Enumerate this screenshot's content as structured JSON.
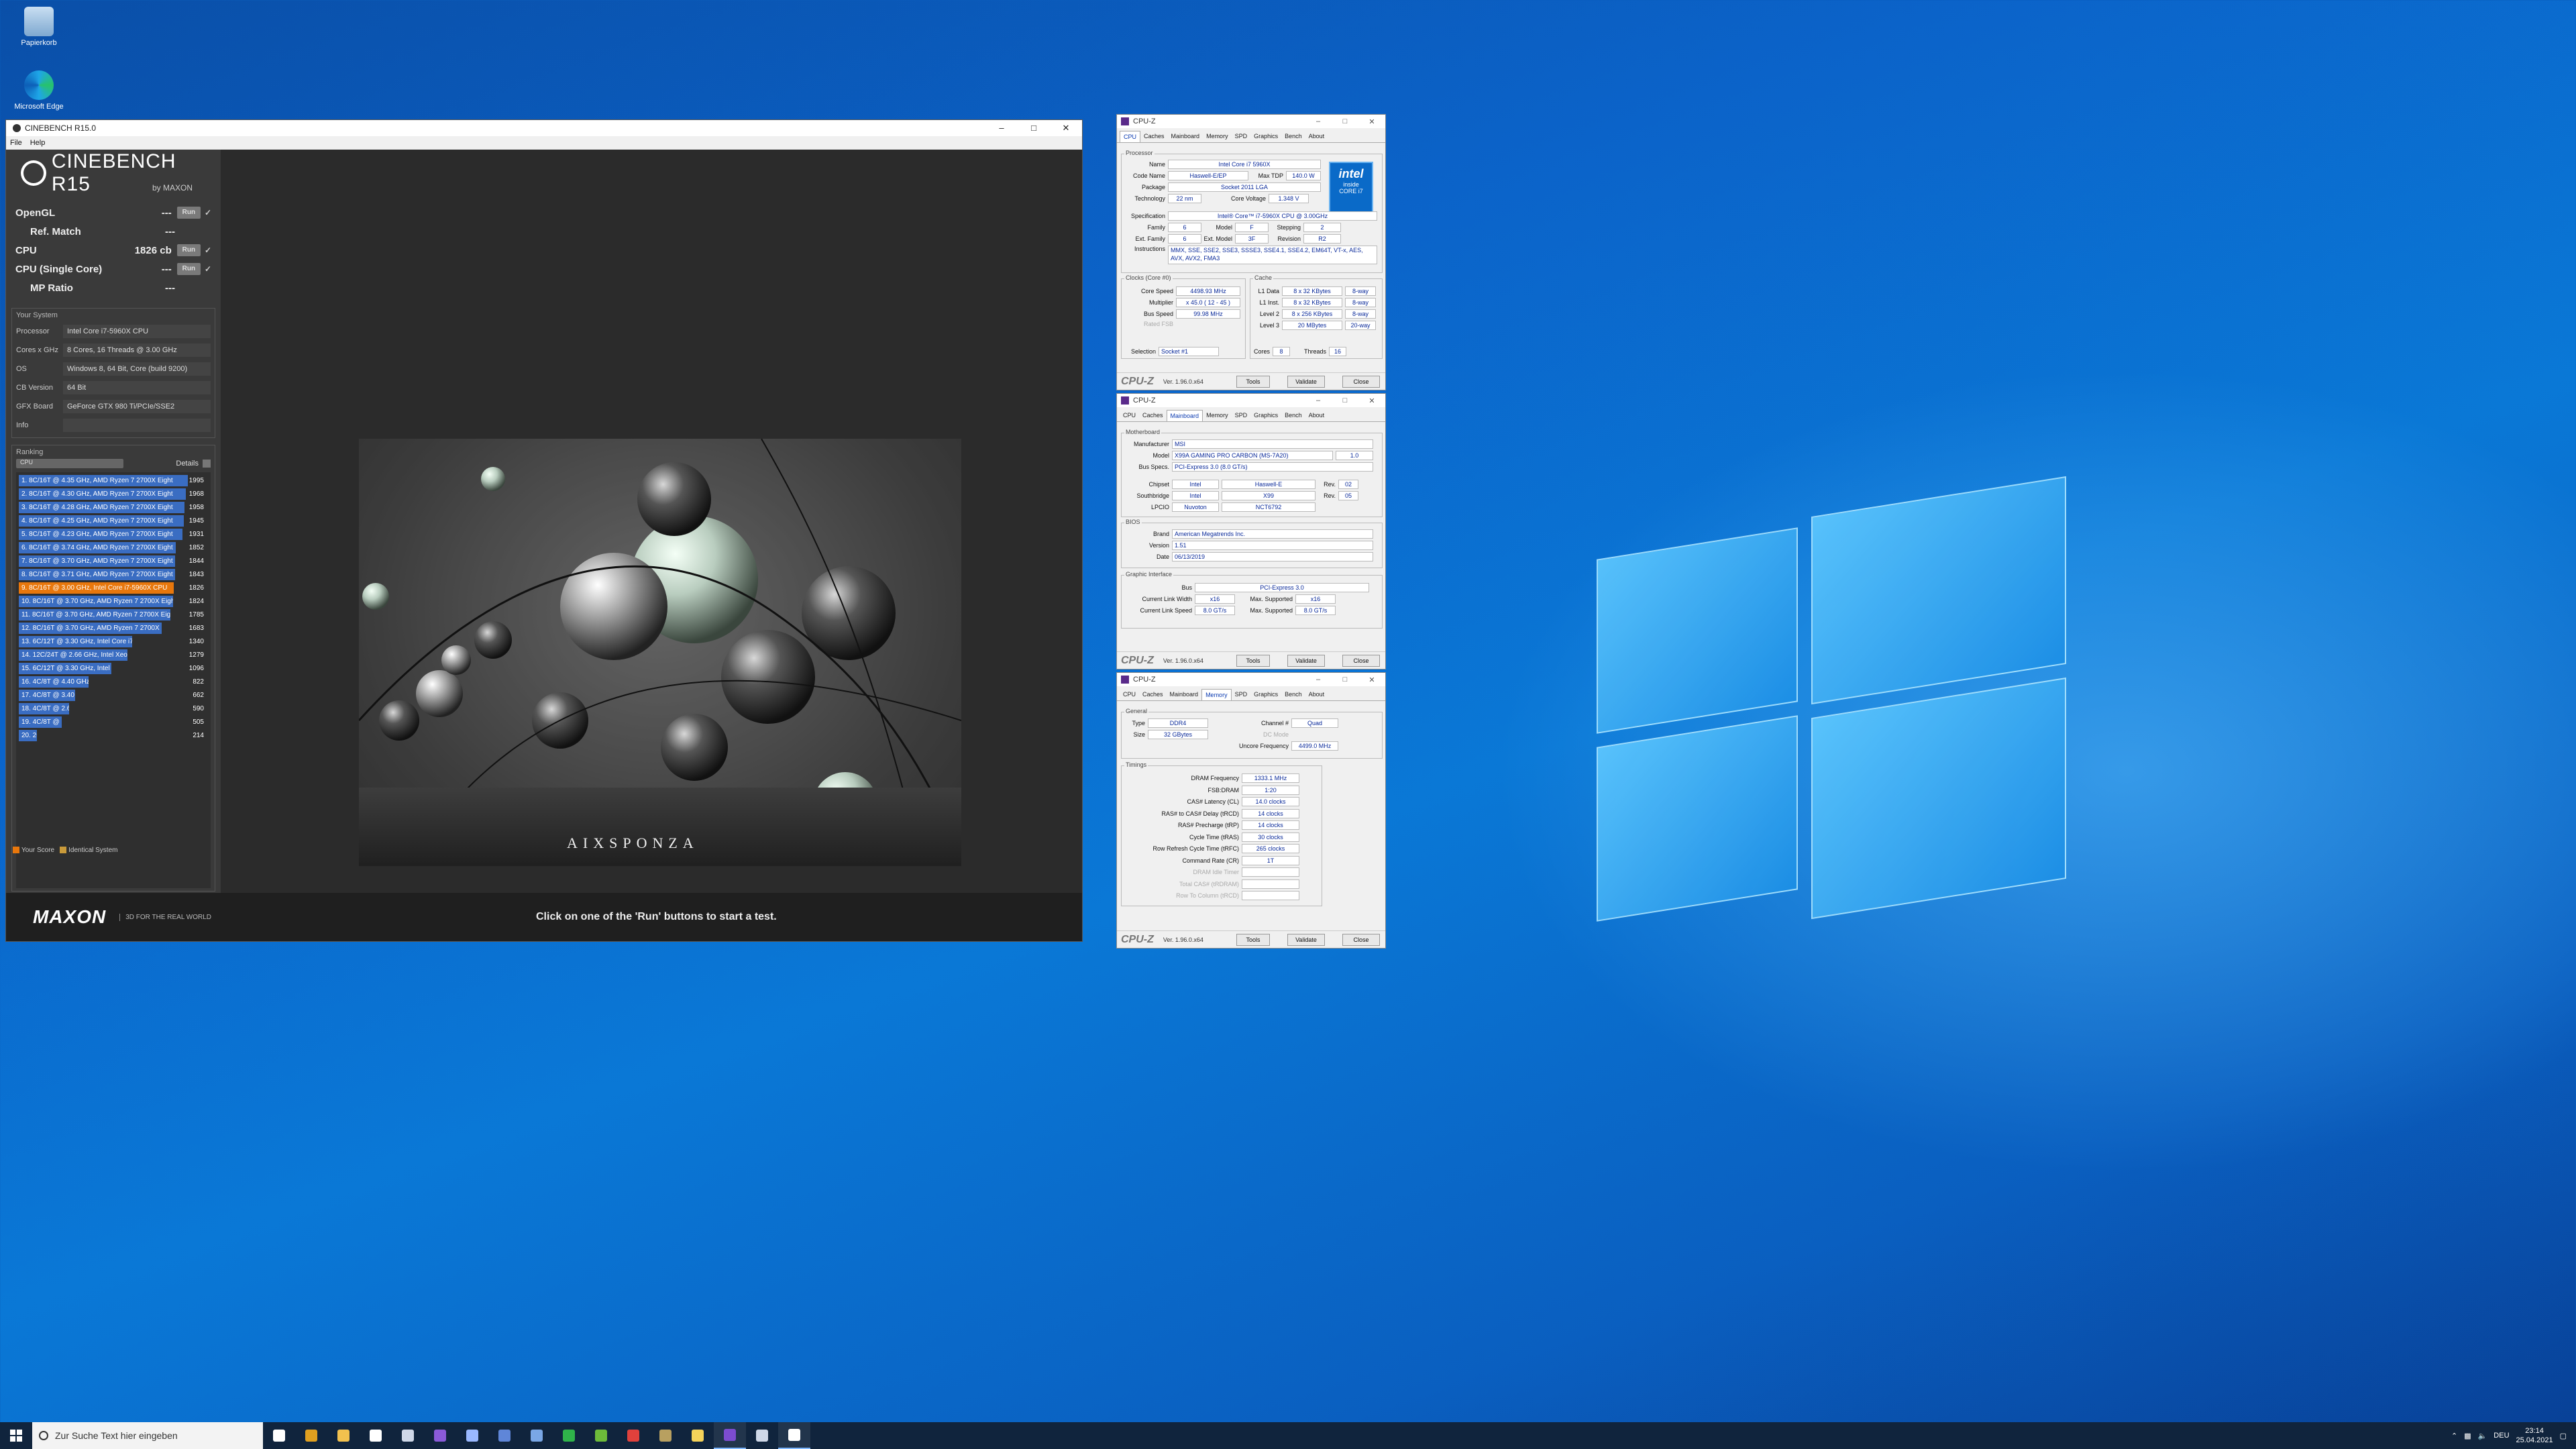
{
  "desktop": {
    "icons": [
      {
        "label": "Papierkorb",
        "icon": "recycle-bin-icon"
      },
      {
        "label": "Microsoft Edge",
        "icon": "edge-icon"
      }
    ]
  },
  "cinebench": {
    "window_title": "CINEBENCH R15.0",
    "menu": [
      "File",
      "Help"
    ],
    "logo_title": "CINEBENCH R15",
    "logo_sub": "by MAXON",
    "tests": [
      {
        "name": "OpenGL",
        "value": "---",
        "run": "Run",
        "indent": false
      },
      {
        "name": "Ref. Match",
        "value": "---",
        "run": "",
        "indent": true
      },
      {
        "name": "CPU",
        "value": "1826 cb",
        "run": "Run",
        "indent": false
      },
      {
        "name": "CPU (Single Core)",
        "value": "---",
        "run": "Run",
        "indent": false
      },
      {
        "name": "MP Ratio",
        "value": "---",
        "run": "",
        "indent": true
      }
    ],
    "system_header": "Your System",
    "system": [
      {
        "k": "Processor",
        "v": "Intel Core i7-5960X CPU"
      },
      {
        "k": "Cores x GHz",
        "v": "8 Cores, 16 Threads @ 3.00 GHz"
      },
      {
        "k": "OS",
        "v": "Windows 8, 64 Bit, Core (build 9200)"
      },
      {
        "k": "CB Version",
        "v": "64 Bit"
      },
      {
        "k": "GFX Board",
        "v": "GeForce GTX 980 Ti/PCIe/SSE2"
      },
      {
        "k": "Info",
        "v": ""
      }
    ],
    "ranking_header": "Ranking",
    "ranking_select": "CPU",
    "ranking_details": "Details",
    "ranking": [
      {
        "label": "1. 8C/16T @ 4.35 GHz, AMD Ryzen 7 2700X Eight",
        "score": "1995",
        "hl": false
      },
      {
        "label": "2. 8C/16T @ 4.30 GHz, AMD Ryzen 7 2700X Eight",
        "score": "1968",
        "hl": false
      },
      {
        "label": "3. 8C/16T @ 4.28 GHz, AMD Ryzen 7 2700X Eight",
        "score": "1958",
        "hl": false
      },
      {
        "label": "4. 8C/16T @ 4.25 GHz, AMD Ryzen 7 2700X Eight",
        "score": "1945",
        "hl": false
      },
      {
        "label": "5. 8C/16T @ 4.23 GHz, AMD Ryzen 7 2700X Eight",
        "score": "1931",
        "hl": false
      },
      {
        "label": "6. 8C/16T @ 3.74 GHz, AMD Ryzen 7 2700X Eight",
        "score": "1852",
        "hl": false
      },
      {
        "label": "7. 8C/16T @ 3.70 GHz, AMD Ryzen 7 2700X Eight",
        "score": "1844",
        "hl": false
      },
      {
        "label": "8. 8C/16T @ 3.71 GHz, AMD Ryzen 7 2700X Eight",
        "score": "1843",
        "hl": false
      },
      {
        "label": "9. 8C/16T @ 3.00 GHz, Intel Core i7-5960X CPU",
        "score": "1826",
        "hl": true
      },
      {
        "label": "10. 8C/16T @ 3.70 GHz, AMD Ryzen 7 2700X Eight",
        "score": "1824",
        "hl": false
      },
      {
        "label": "11. 8C/16T @ 3.70 GHz, AMD Ryzen 7 2700X Eight",
        "score": "1785",
        "hl": false
      },
      {
        "label": "12. 8C/16T @ 3.70 GHz, AMD Ryzen 7 2700X Eight",
        "score": "1683",
        "hl": false
      },
      {
        "label": "13. 6C/12T @ 3.30 GHz, Intel Core i7-5820K CPU",
        "score": "1340",
        "hl": false
      },
      {
        "label": "14. 12C/24T @ 2.66 GHz, Intel Xeon CPU X5650",
        "score": "1279",
        "hl": false
      },
      {
        "label": "15. 6C/12T @ 3.30 GHz, Intel Core i7-3930K CPU",
        "score": "1096",
        "hl": false
      },
      {
        "label": "16. 4C/8T @ 4.40 GHz, Intel Core i7-4770K CPU",
        "score": "822",
        "hl": false
      },
      {
        "label": "17. 4C/8T @ 3.40 GHz, Intel Core i7-3770 CPU",
        "score": "662",
        "hl": false
      },
      {
        "label": "18. 4C/8T @ 2.60 GHz, Intel Core i7-3720QM CPU",
        "score": "590",
        "hl": false
      },
      {
        "label": "19. 4C/8T @ 2.79 GHz, Intel Core i7-3840QM CPU",
        "score": "505",
        "hl": false
      },
      {
        "label": "20. 2C/4T @ 1.70 GHz, Intel Core i5-3317U CPU",
        "score": "214",
        "hl": false
      }
    ],
    "ranking_bar_fraction": [
      1.0,
      0.987,
      0.981,
      0.975,
      0.968,
      0.928,
      0.924,
      0.924,
      0.915,
      0.914,
      0.895,
      0.844,
      0.672,
      0.641,
      0.549,
      0.412,
      0.332,
      0.296,
      0.253,
      0.107
    ],
    "legend_your_score": "Your Score",
    "legend_identical": "Identical System",
    "footer_brand": "MAXON",
    "footer_tag": "3D FOR THE REAL WORLD",
    "footer_hint": "Click on one of the 'Run' buttons to start a test.",
    "render_watermark": "AIXSPONZA",
    "colors": {
      "rank_bar": "#3a6dc2",
      "your_score": "#e8770c"
    }
  },
  "cpuz_cpu": {
    "title": "CPU-Z",
    "tabs": [
      "CPU",
      "Caches",
      "Mainboard",
      "Memory",
      "SPD",
      "Graphics",
      "Bench",
      "About"
    ],
    "active_tab": "CPU",
    "processor_group": "Processor",
    "name_k": "Name",
    "name_v": "Intel Core i7 5960X",
    "codename_k": "Code Name",
    "codename_v": "Haswell-E/EP",
    "maxtdp_k": "Max TDP",
    "maxtdp_v": "140.0 W",
    "package_k": "Package",
    "package_v": "Socket 2011 LGA",
    "tech_k": "Technology",
    "tech_v": "22 nm",
    "cvolt_k": "Core Voltage",
    "cvolt_v": "1.348 V",
    "spec_k": "Specification",
    "spec_v": "Intel® Core™ i7-5960X CPU @ 3.00GHz",
    "family_k": "Family",
    "family_v": "6",
    "model_k": "Model",
    "model_v": "F",
    "stepping_k": "Stepping",
    "stepping_v": "2",
    "extfam_k": "Ext. Family",
    "extfam_v": "6",
    "extmodel_k": "Ext. Model",
    "extmodel_v": "3F",
    "rev_k": "Revision",
    "rev_v": "R2",
    "instr_k": "Instructions",
    "instr_v": "MMX, SSE, SSE2, SSE3, SSSE3, SSE4.1, SSE4.2, EM64T, VT-x, AES, AVX, AVX2, FMA3",
    "clocks_group": "Clocks (Core #0)",
    "cspeed_k": "Core Speed",
    "cspeed_v": "4498.93 MHz",
    "mult_k": "Multiplier",
    "mult_v": "x 45.0 ( 12 - 45 )",
    "bus_k": "Bus Speed",
    "bus_v": "99.98 MHz",
    "fsb_k": "Rated FSB",
    "cache_group": "Cache",
    "l1d_k": "L1 Data",
    "l1d_v": "8 x 32 KBytes",
    "l1d_w": "8-way",
    "l1i_k": "L1 Inst.",
    "l1i_v": "8 x 32 KBytes",
    "l1i_w": "8-way",
    "l2_k": "Level 2",
    "l2_v": "8 x 256 KBytes",
    "l2_w": "8-way",
    "l3_k": "Level 3",
    "l3_v": "20 MBytes",
    "l3_w": "20-way",
    "selection_k": "Selection",
    "selection_v": "Socket #1",
    "cores_k": "Cores",
    "cores_v": "8",
    "threads_k": "Threads",
    "threads_v": "16",
    "intel_badge": {
      "brand": "intel",
      "line1": "inside",
      "line2": "CORE i7"
    },
    "footer_logo": "CPU-Z",
    "version": "Ver. 1.96.0.x64",
    "tools": "Tools",
    "validate": "Validate",
    "close": "Close"
  },
  "cpuz_mb": {
    "title": "CPU-Z",
    "tabs": [
      "CPU",
      "Caches",
      "Mainboard",
      "Memory",
      "SPD",
      "Graphics",
      "Bench",
      "About"
    ],
    "active_tab": "Mainboard",
    "mb_group": "Motherboard",
    "manu_k": "Manufacturer",
    "manu_v": "MSI",
    "model_k": "Model",
    "model_v": "X99A GAMING PRO CARBON (MS-7A20)",
    "model_rev": "1.0",
    "busspec_k": "Bus Specs.",
    "busspec_v": "PCI-Express 3.0 (8.0 GT/s)",
    "chipset_k": "Chipset",
    "chipset_v1": "Intel",
    "chipset_v2": "Haswell-E",
    "chipset_rk": "Rev.",
    "chipset_rv": "02",
    "south_k": "Southbridge",
    "south_v1": "Intel",
    "south_v2": "X99",
    "south_rk": "Rev.",
    "south_rv": "05",
    "lpcio_k": "LPCIO",
    "lpcio_v1": "Nuvoton",
    "lpcio_v2": "NCT6792",
    "bios_group": "BIOS",
    "brand_k": "Brand",
    "brand_v": "American Megatrends Inc.",
    "ver_k": "Version",
    "ver_v": "1.51",
    "date_k": "Date",
    "date_v": "06/13/2019",
    "gi_group": "Graphic Interface",
    "gbus_k": "Bus",
    "gbus_v": "PCI-Express 3.0",
    "clw_k": "Current Link Width",
    "clw_v": "x16",
    "msw_k": "Max. Supported",
    "msw_v": "x16",
    "cls_k": "Current Link Speed",
    "cls_v": "8.0 GT/s",
    "mss_k": "Max. Supported",
    "mss_v": "8.0 GT/s",
    "footer_logo": "CPU-Z",
    "version": "Ver. 1.96.0.x64",
    "tools": "Tools",
    "validate": "Validate",
    "close": "Close"
  },
  "cpuz_mem": {
    "title": "CPU-Z",
    "tabs": [
      "CPU",
      "Caches",
      "Mainboard",
      "Memory",
      "SPD",
      "Graphics",
      "Bench",
      "About"
    ],
    "active_tab": "Memory",
    "gen_group": "General",
    "type_k": "Type",
    "type_v": "DDR4",
    "size_k": "Size",
    "size_v": "32 GBytes",
    "chan_k": "Channel #",
    "chan_v": "Quad",
    "dcm_k": "DC Mode",
    "unc_k": "Uncore Frequency",
    "unc_v": "4499.0 MHz",
    "tim_group": "Timings",
    "timings": [
      {
        "k": "DRAM Frequency",
        "v": "1333.1 MHz",
        "dim": false
      },
      {
        "k": "FSB:DRAM",
        "v": "1:20",
        "dim": false
      },
      {
        "k": "CAS# Latency (CL)",
        "v": "14.0 clocks",
        "dim": false
      },
      {
        "k": "RAS# to CAS# Delay (tRCD)",
        "v": "14 clocks",
        "dim": false
      },
      {
        "k": "RAS# Precharge (tRP)",
        "v": "14 clocks",
        "dim": false
      },
      {
        "k": "Cycle Time (tRAS)",
        "v": "30 clocks",
        "dim": false
      },
      {
        "k": "Row Refresh Cycle Time (tRFC)",
        "v": "265 clocks",
        "dim": false
      },
      {
        "k": "Command Rate (CR)",
        "v": "1T",
        "dim": false
      },
      {
        "k": "DRAM Idle Timer",
        "v": "",
        "dim": true
      },
      {
        "k": "Total CAS# (tRDRAM)",
        "v": "",
        "dim": true
      },
      {
        "k": "Row To Column (tRCD)",
        "v": "",
        "dim": true
      }
    ],
    "footer_logo": "CPU-Z",
    "version": "Ver. 1.96.0.x64",
    "tools": "Tools",
    "validate": "Validate",
    "close": "Close"
  },
  "taskbar": {
    "search_placeholder": "Zur Suche Text hier eingeben",
    "apps": [
      {
        "icon": "task-view-icon",
        "color": "#ffffff",
        "active": false
      },
      {
        "icon": "chrome-icon",
        "color": "#e0a020",
        "active": false
      },
      {
        "icon": "file-explorer-icon",
        "color": "#f2c14e",
        "active": false
      },
      {
        "icon": "store-icon",
        "color": "#ffffff",
        "active": false
      },
      {
        "icon": "app-window-icon",
        "color": "#cfd8e8",
        "active": false
      },
      {
        "icon": "app-purple-icon",
        "color": "#8a5ad8",
        "active": false
      },
      {
        "icon": "app-circle-icon",
        "color": "#9ab8ff",
        "active": false
      },
      {
        "icon": "app-circle2-icon",
        "color": "#5f86d8",
        "active": false
      },
      {
        "icon": "app-monitor-icon",
        "color": "#7aa7e6",
        "active": false
      },
      {
        "icon": "app-green-icon",
        "color": "#2fb34a",
        "active": false
      },
      {
        "icon": "app-gpu-icon",
        "color": "#6dbb3a",
        "active": false
      },
      {
        "icon": "app-dark-icon",
        "color": "#e0413c",
        "active": false
      },
      {
        "icon": "app-hw-icon",
        "color": "#b8a060",
        "active": false
      },
      {
        "icon": "app-yellow-icon",
        "color": "#f5d35a",
        "active": false
      },
      {
        "icon": "cpuz-icon",
        "color": "#7c4ccf",
        "active": true
      },
      {
        "icon": "app-window2-icon",
        "color": "#cfd8e8",
        "active": false
      },
      {
        "icon": "cinebench-icon",
        "color": "#ffffff",
        "active": true
      }
    ],
    "lang": "DEU",
    "time": "23:14",
    "date": "25.04.2021"
  }
}
